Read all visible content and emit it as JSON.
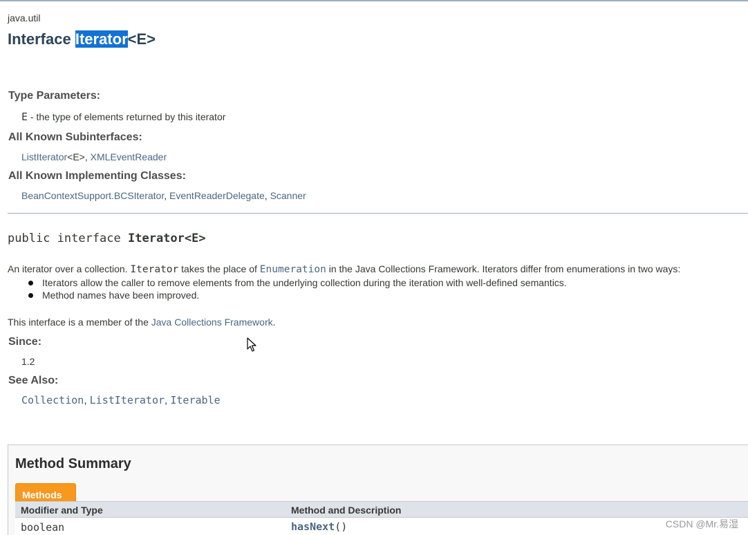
{
  "header": {
    "package": "java.util",
    "title_prefix": "Interface ",
    "title_highlight": "Iterator",
    "title_suffix": "<E>"
  },
  "type_parameters": {
    "label": "Type Parameters:",
    "param_name": "E",
    "param_desc": " - the type of elements returned by this iterator"
  },
  "subinterfaces": {
    "label": "All Known Subinterfaces:",
    "items": [
      {
        "name": "ListIterator",
        "suffix": "<E>, "
      },
      {
        "name": "XMLEventReader",
        "suffix": ""
      }
    ]
  },
  "implementing_classes": {
    "label": "All Known Implementing Classes:",
    "items": [
      {
        "name": "BeanContextSupport.BCSIterator",
        "suffix": ", "
      },
      {
        "name": "EventReaderDelegate",
        "suffix": ", "
      },
      {
        "name": "Scanner",
        "suffix": ""
      }
    ]
  },
  "signature": {
    "prefix": "public interface ",
    "name": "Iterator<E>"
  },
  "description": {
    "part1": "An iterator over a collection. ",
    "code1": "Iterator",
    "part2": " takes the place of ",
    "link1": "Enumeration",
    "part3": " in the Java Collections Framework. Iterators differ from enumerations in two ways:",
    "bullets": [
      "Iterators allow the caller to remove elements from the underlying collection during the iteration with well-defined semantics.",
      "Method names have been improved."
    ],
    "member_prefix": "This interface is a member of the ",
    "member_link": "Java Collections Framework",
    "member_suffix": "."
  },
  "since": {
    "label": "Since:",
    "value": "1.2"
  },
  "see_also": {
    "label": "See Also:",
    "items": [
      {
        "name": "Collection",
        "suffix": ", "
      },
      {
        "name": "ListIterator",
        "suffix": ", "
      },
      {
        "name": "Iterable",
        "suffix": ""
      }
    ]
  },
  "method_summary": {
    "title": "Method Summary",
    "tab_label": "Methods",
    "col1": "Modifier and Type",
    "col2": "Method and Description",
    "rows": [
      {
        "type": "boolean",
        "method": "hasNext",
        "params": "()"
      }
    ]
  },
  "watermark": "CSDN @Mr.易湿",
  "colors": {
    "link": "#4a6782",
    "highlight": "#1372d3",
    "tab": "#f8981d"
  }
}
